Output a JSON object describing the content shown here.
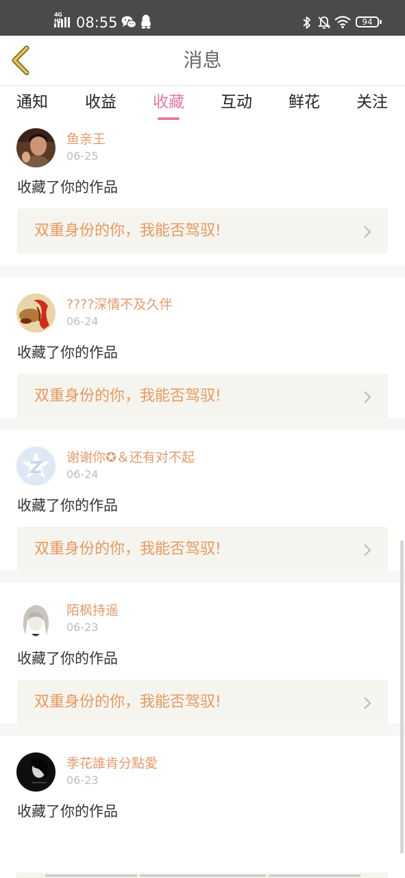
{
  "status_bar": {
    "network": "4G HD",
    "time": "08:55",
    "battery": "94"
  },
  "header": {
    "title": "消息"
  },
  "tabs": [
    {
      "label": "通知",
      "active": false
    },
    {
      "label": "收益",
      "active": false
    },
    {
      "label": "收藏",
      "active": true
    },
    {
      "label": "互动",
      "active": false
    },
    {
      "label": "鲜花",
      "active": false
    },
    {
      "label": "关注",
      "active": false
    }
  ],
  "messages": [
    {
      "user": "鱼亲王",
      "date": "06-25",
      "action": "收藏了你的作品",
      "work_title": "双重身份的你，我能否驾驭!"
    },
    {
      "user": "????深情不及久伴",
      "date": "06-24",
      "action": "收藏了你的作品",
      "work_title": "双重身份的你，我能否驾驭!"
    },
    {
      "user": "谢谢你✪＆还有对不起",
      "date": "06-24",
      "action": "收藏了你的作品",
      "work_title": "双重身份的你，我能否驾驭!"
    },
    {
      "user": "陌枫持遥",
      "date": "06-23",
      "action": "收藏了你的作品",
      "work_title": "双重身份的你，我能否驾驭!"
    },
    {
      "user": "季花誰肯分點愛",
      "date": "06-23",
      "action": "收藏了你的作品",
      "work_title": ""
    }
  ],
  "colors": {
    "accent_pink": "#e67aa6",
    "username_orange": "#e39b6b",
    "work_title_orange": "#e8995f",
    "work_bg": "#f5f4ee",
    "back_arrow": "#e8c64a"
  }
}
